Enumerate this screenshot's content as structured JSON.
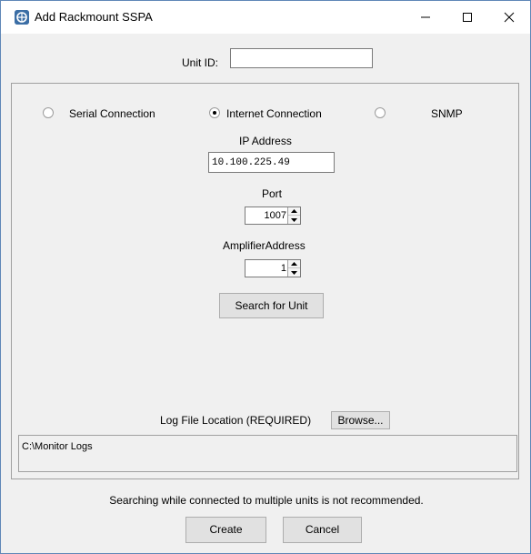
{
  "window": {
    "title": "Add Rackmount SSPA",
    "icon": "app-logo-icon"
  },
  "unit_id": {
    "label": "Unit ID:",
    "value": ""
  },
  "connection": {
    "options": [
      {
        "label": "Serial Connection",
        "checked": false
      },
      {
        "label": "Internet Connection",
        "checked": true
      },
      {
        "label": "SNMP",
        "checked": false
      }
    ]
  },
  "ip": {
    "label": "IP Address",
    "value": "10.100.225.49"
  },
  "port": {
    "label": "Port",
    "value": "1007"
  },
  "amplifier": {
    "label": "AmplifierAddress",
    "value": "1"
  },
  "buttons": {
    "search": "Search for Unit",
    "browse": "Browse...",
    "create": "Create",
    "cancel": "Cancel"
  },
  "log": {
    "label": "Log File Location (REQUIRED)",
    "path": "C:\\Monitor Logs"
  },
  "note": "Searching while connected to multiple units is not recommended."
}
